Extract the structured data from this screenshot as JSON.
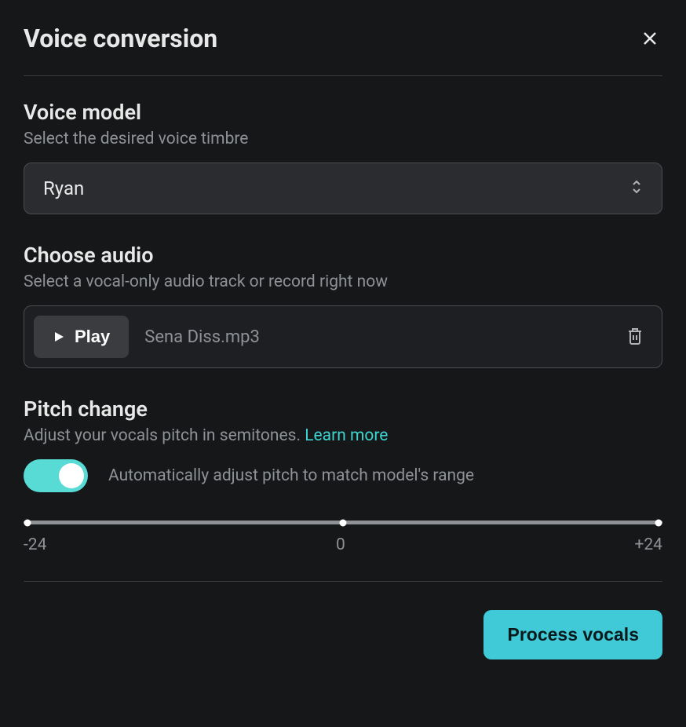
{
  "header": {
    "title": "Voice conversion"
  },
  "voiceModel": {
    "title": "Voice model",
    "desc": "Select the desired voice timbre",
    "selected": "Ryan"
  },
  "audio": {
    "title": "Choose audio",
    "desc": "Select a vocal-only audio track or record right now",
    "playLabel": "Play",
    "filename": "Sena Diss.mp3"
  },
  "pitch": {
    "title": "Pitch change",
    "desc": "Adjust your vocals pitch in semitones. ",
    "learnMore": "Learn more",
    "toggleLabel": "Automatically adjust pitch to match model's range",
    "min": "-24",
    "mid": "0",
    "max": "+24"
  },
  "footer": {
    "process": "Process vocals"
  }
}
